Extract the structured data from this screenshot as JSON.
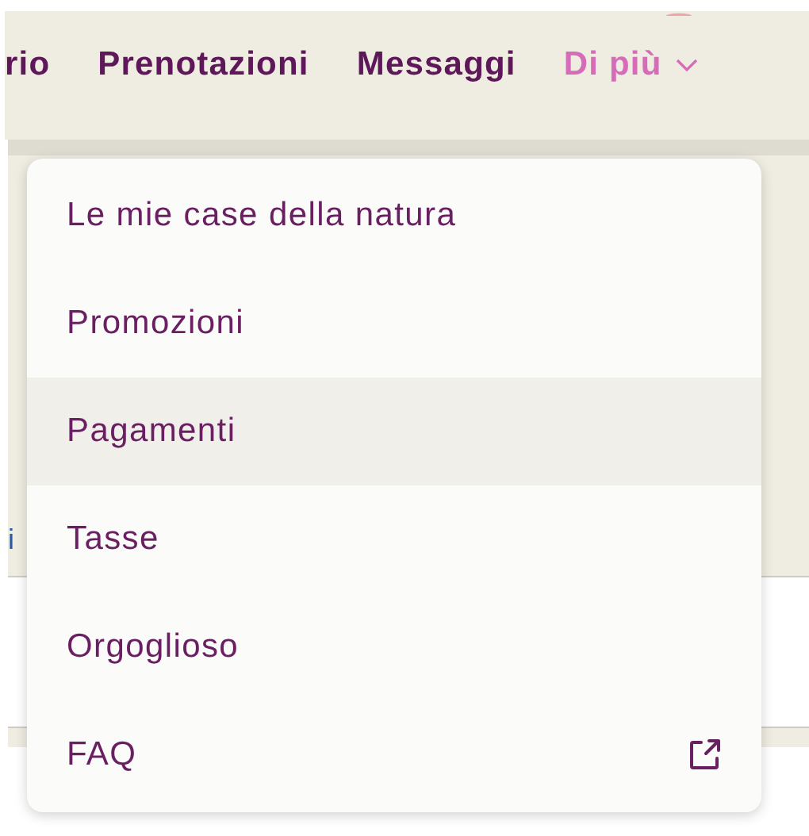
{
  "nav": {
    "items": [
      {
        "label": "rio",
        "selected": false,
        "has_menu": false
      },
      {
        "label": "Prenotazioni",
        "selected": false,
        "has_menu": false
      },
      {
        "label": "Messaggi",
        "selected": false,
        "has_menu": false
      },
      {
        "label": "Di più",
        "selected": true,
        "has_menu": true
      }
    ]
  },
  "background_text": "i",
  "menu": {
    "items": [
      {
        "label": "Le mie case della natura",
        "selected": false,
        "external": false
      },
      {
        "label": "Promozioni",
        "selected": false,
        "external": false
      },
      {
        "label": "Pagamenti",
        "selected": true,
        "external": false
      },
      {
        "label": "Tasse",
        "selected": false,
        "external": false
      },
      {
        "label": "Orgoglioso",
        "selected": false,
        "external": false
      },
      {
        "label": "FAQ",
        "selected": false,
        "external": true
      }
    ]
  }
}
